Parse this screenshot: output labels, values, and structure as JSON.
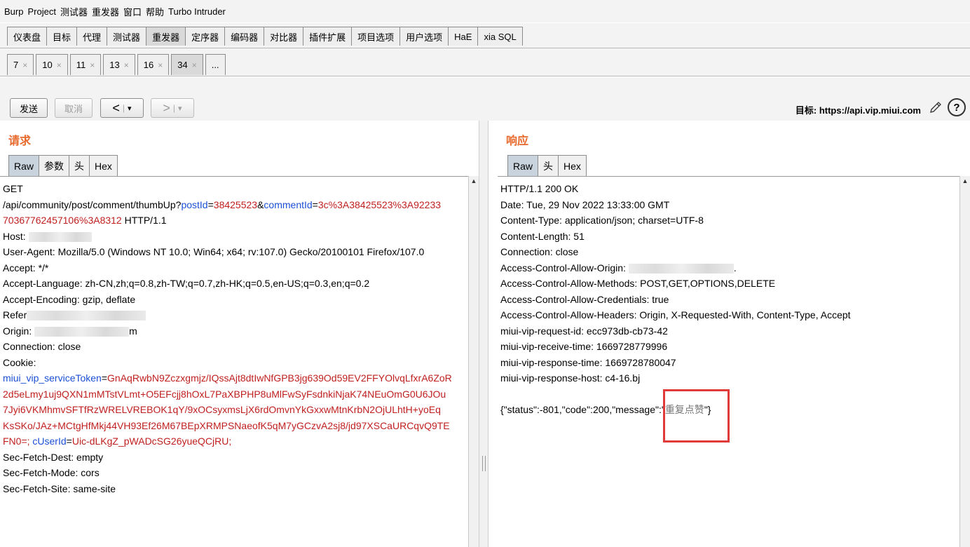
{
  "menu": [
    "Burp",
    "Project",
    "测试器",
    "重发器",
    "窗口",
    "帮助",
    "Turbo Intruder"
  ],
  "main_tabs": [
    {
      "label": "仪表盘",
      "active": false
    },
    {
      "label": "目标",
      "active": false
    },
    {
      "label": "代理",
      "active": false
    },
    {
      "label": "测试器",
      "active": false
    },
    {
      "label": "重发器",
      "active": true
    },
    {
      "label": "定序器",
      "active": false
    },
    {
      "label": "编码器",
      "active": false
    },
    {
      "label": "对比器",
      "active": false
    },
    {
      "label": "插件扩展",
      "active": false
    },
    {
      "label": "项目选项",
      "active": false
    },
    {
      "label": "用户选项",
      "active": false
    },
    {
      "label": "HaE",
      "active": false
    },
    {
      "label": "xia SQL",
      "active": false
    }
  ],
  "repeater_tabs": [
    {
      "label": "7",
      "active": false
    },
    {
      "label": "10",
      "active": false
    },
    {
      "label": "11",
      "active": false
    },
    {
      "label": "13",
      "active": false
    },
    {
      "label": "16",
      "active": false
    },
    {
      "label": "34",
      "active": true
    }
  ],
  "repeater_more": "...",
  "close_glyph": "×",
  "toolbar": {
    "send": "发送",
    "cancel": "取消",
    "prev": "<",
    "next": ">",
    "dropdown": "▾",
    "target_label": "目标: https://api.vip.miui.com",
    "help": "?"
  },
  "request": {
    "title": "请求",
    "view_tabs": [
      "Raw",
      "参数",
      "头",
      "Hex"
    ],
    "lines": {
      "l1": "GET",
      "l2_path": "/api/community/post/comment/thumbUp?",
      "l2_k1": "postId",
      "l2_eq": "=",
      "l2_v1": "38425523",
      "l2_amp": "&",
      "l2_k2": "commentId",
      "l2_v2": "3c%3A38425523%3A92233",
      "l3_v": "70367762457106%3A8312",
      "l3_rest": " HTTP/1.1",
      "l4": "Host: ",
      "l5": "User-Agent: Mozilla/5.0 (Windows NT 10.0; Win64; x64; rv:107.0) Gecko/20100101 Firefox/107.0",
      "l6": "Accept: */*",
      "l7": "Accept-Language: zh-CN,zh;q=0.8,zh-TW;q=0.7,zh-HK;q=0.5,en-US;q=0.3,en;q=0.2",
      "l8": "Accept-Encoding: gzip, deflate",
      "l9": "Refer",
      "l10": "Origin: ",
      "l10_tail": "m",
      "l11": "Connection: close",
      "l12": "Cookie:",
      "l13_k": "miui_vip_serviceToken",
      "l13_v": "GnAqRwbN9Zczxgmjz/IQssAjt8dtIwNfGPB3jg639Od59EV2FFYOlvqLfxrA6ZoR",
      "l14": "2d5eLmy1uj9QXN1mMTstVLmt+O5EFcjj8hOxL7PaXBPHP8uMlFwSyFsdnkiNjaK74NEuOmG0U6JOu",
      "l15": "7Jyi6VKMhmvSFTfRzWRELVREBOK1qY/9xOCsyxmsLjX6rdOmvnYkGxxwMtnKrbN2OjULhtH+yoEq",
      "l16": "KsSKo/JAz+MCtgHfMkj44VH93Ef26M67BEpXRMPSNaeofK5qM7yGCzvA2sj8/jd97XSCaURCqvQ9TE",
      "l17_v": "FN0=; ",
      "l17_k": "cUserId",
      "l17_v2": "Uic-dLKgZ_pWADcSG26yueQCjRU;",
      "l18": "Sec-Fetch-Dest: empty",
      "l19": "Sec-Fetch-Mode: cors",
      "l20": "Sec-Fetch-Site: same-site"
    }
  },
  "response": {
    "title": "响应",
    "view_tabs": [
      "Raw",
      "头",
      "Hex"
    ],
    "lines": {
      "l1": "HTTP/1.1 200 OK",
      "l2": "Date: Tue, 29 Nov 2022 13:33:00 GMT",
      "l3": "Content-Type: application/json; charset=UTF-8",
      "l4": "Content-Length: 51",
      "l5": "Connection: close",
      "l6": "Access-Control-Allow-Origin: ",
      "l6_tail": ".",
      "l7": "Access-Control-Allow-Methods: POST,GET,OPTIONS,DELETE",
      "l8": "Access-Control-Allow-Credentials: true",
      "l9": "Access-Control-Allow-Headers: Origin, X-Requested-With, Content-Type, Accept",
      "l10": "miui-vip-request-id: ecc973db-cb73-42",
      "l11": "miui-vip-receive-time: 1669728779996",
      "l12": "miui-vip-response-time: 1669728780047",
      "l13": "miui-vip-response-host: c4-16.bj",
      "l15_a": "{\"status\":-801,\"code\":200,\"message\":\"",
      "l15_b": "重复点赞",
      "l15_c": "\"}"
    }
  }
}
